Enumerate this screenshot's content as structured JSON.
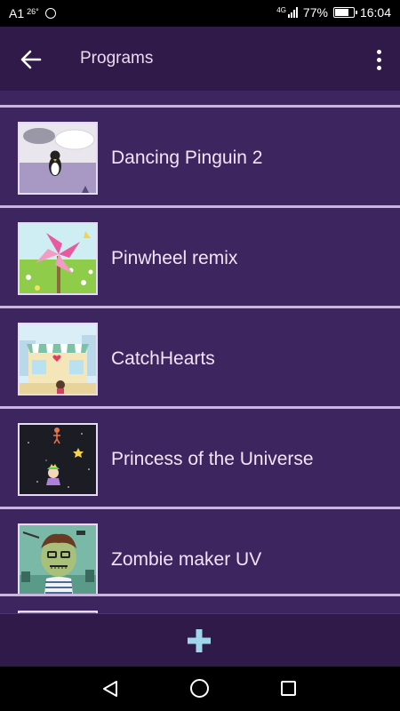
{
  "status": {
    "carrier": "A1",
    "temperature": "26°",
    "network": "4G",
    "battery": "77%",
    "battery_level": 0.77,
    "time": "16:04"
  },
  "app_bar": {
    "title": "Programs",
    "back_icon": "arrow-left-icon",
    "menu_icon": "more-vertical-icon"
  },
  "programs": [
    {
      "name": "Dancing Pinguin 2"
    },
    {
      "name": "Pinwheel remix"
    },
    {
      "name": "CatchHearts"
    },
    {
      "name": "Princess of the Universe"
    },
    {
      "name": "Zombie maker UV"
    },
    {
      "name": ""
    }
  ],
  "bottom_bar": {
    "add_icon": "plus-icon"
  },
  "nav": {
    "back_icon": "triangle-back-icon",
    "home_icon": "circle-home-icon",
    "recent_icon": "square-recent-icon"
  },
  "colors": {
    "app_bar": "#2f1a4a",
    "list_background": "#3d2660",
    "divider": "#c8b5e0",
    "accent_plus": "#9fd6ee"
  }
}
